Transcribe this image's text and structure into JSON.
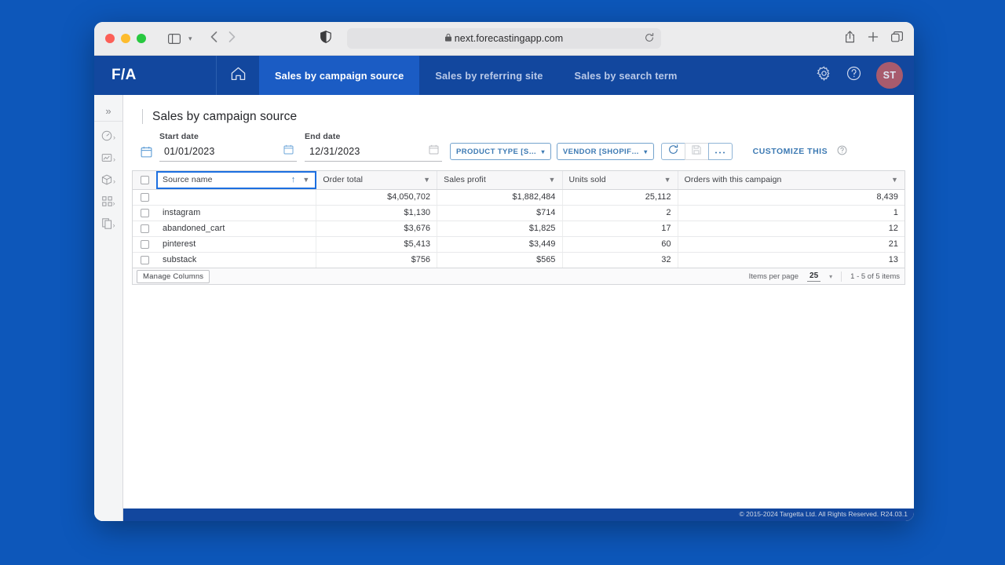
{
  "browser": {
    "url": "next.forecastingapp.com",
    "lock_icon": "lock-icon",
    "reload_icon": "reload-icon",
    "back_icon": "back-arrow-icon",
    "forward_icon": "forward-arrow-icon",
    "sidebar_icon": "sidebar-toggle-icon",
    "shield_icon": "privacy-shield-icon",
    "share_icon": "share-icon",
    "newtab_icon": "plus-icon",
    "tabs_icon": "tab-overview-icon"
  },
  "appnav": {
    "brand": "F/A",
    "home_icon": "home-icon",
    "tabs": [
      {
        "label": "Sales by campaign source",
        "active": true
      },
      {
        "label": "Sales by referring site",
        "active": false
      },
      {
        "label": "Sales by search term",
        "active": false
      }
    ],
    "settings_icon": "gear-icon",
    "help_icon": "help-circle-icon",
    "avatar_initials": "ST",
    "avatar_color": "#a85b6d",
    "bar_color": "#12479e",
    "active_tab_color": "#1b5cc4"
  },
  "sidebar": {
    "expand_label": "»",
    "items": [
      {
        "icon": "gauge-icon",
        "chevron": "›"
      },
      {
        "icon": "chart-image-icon",
        "chevron": "›"
      },
      {
        "icon": "package-box-icon",
        "chevron": "›"
      },
      {
        "icon": "grid-apps-icon",
        "chevron": "›"
      },
      {
        "icon": "documents-icon",
        "chevron": "›"
      }
    ]
  },
  "page": {
    "title": "Sales by campaign source",
    "calendar_lead_icon": "calendar-icon",
    "start_date": {
      "label": "Start date",
      "value": "01/01/2023",
      "icon": "calendar-icon"
    },
    "end_date": {
      "label": "End date",
      "value": "12/31/2023",
      "icon": "calendar-icon"
    },
    "filters": [
      {
        "label": "PRODUCT TYPE [S…",
        "chevron": "⌄"
      },
      {
        "label": "VENDOR [SHOPIF…",
        "chevron": "⌄"
      }
    ],
    "toolbar_buttons": [
      {
        "icon": "refresh-icon",
        "disabled": false
      },
      {
        "icon": "save-icon",
        "disabled": true
      },
      {
        "icon": "more-ellipsis-icon",
        "disabled": false
      }
    ],
    "customize_label": "CUSTOMIZE THIS",
    "customize_help_icon": "help-circle-icon"
  },
  "table": {
    "select_all_checkbox": "checkbox",
    "columns": [
      {
        "label": "Source name",
        "align": "left",
        "sorted": true,
        "sort_icon": "sort-ascending-icon",
        "filter_icon": "filter-icon"
      },
      {
        "label": "Order total",
        "align": "right",
        "sorted": false,
        "filter_icon": "filter-icon"
      },
      {
        "label": "Sales profit",
        "align": "right",
        "sorted": false,
        "filter_icon": "filter-icon"
      },
      {
        "label": "Units sold",
        "align": "right",
        "sorted": false,
        "filter_icon": "filter-icon"
      },
      {
        "label": "Orders with this campaign",
        "align": "right",
        "sorted": false,
        "filter_icon": "filter-icon"
      }
    ],
    "rows": [
      {
        "source_name": "",
        "order_total": "$4,050,702",
        "sales_profit": "$1,882,484",
        "units_sold": "25,112",
        "orders": "8,439"
      },
      {
        "source_name": "instagram",
        "order_total": "$1,130",
        "sales_profit": "$714",
        "units_sold": "2",
        "orders": "1"
      },
      {
        "source_name": "abandoned_cart",
        "order_total": "$3,676",
        "sales_profit": "$1,825",
        "units_sold": "17",
        "orders": "12"
      },
      {
        "source_name": "pinterest",
        "order_total": "$5,413",
        "sales_profit": "$3,449",
        "units_sold": "60",
        "orders": "21"
      },
      {
        "source_name": "substack",
        "order_total": "$756",
        "sales_profit": "$565",
        "units_sold": "32",
        "orders": "13"
      }
    ],
    "footer": {
      "manage_columns_label": "Manage Columns",
      "items_per_page_label": "Items per page",
      "items_per_page_value": "25",
      "items_per_page_chevron": "⌄",
      "range_label": "1 - 5 of 5 items"
    }
  },
  "footer": {
    "copyright": "© 2015-2024 Targetta Ltd. All Rights Reserved. R24.03.1"
  }
}
